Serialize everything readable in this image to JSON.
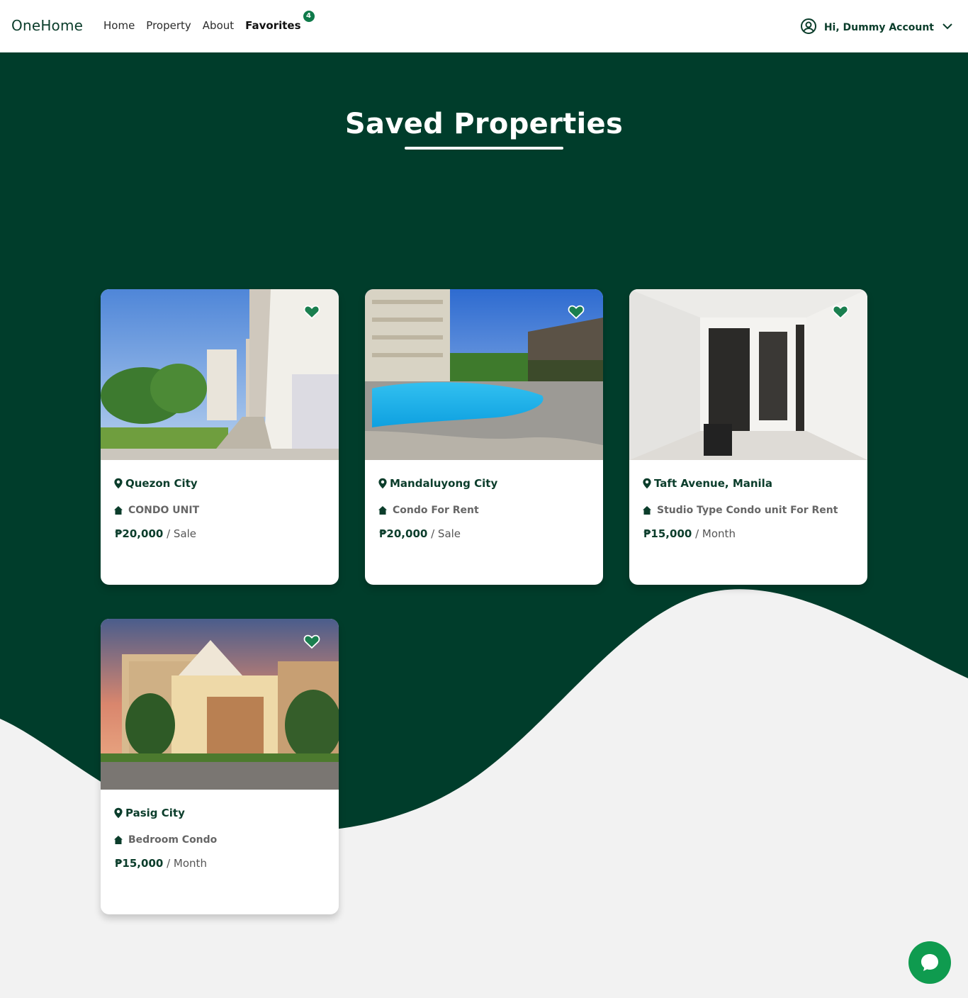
{
  "nav": {
    "brand": "OneHome",
    "links": [
      {
        "label": "Home"
      },
      {
        "label": "Property"
      },
      {
        "label": "About"
      },
      {
        "label": "Favorites"
      }
    ],
    "favorites_count": "4",
    "account_label": "Hi, Dummy Account"
  },
  "page": {
    "title": "Saved Properties"
  },
  "colors": {
    "brand_dark": "#003d2b",
    "accent": "#0f7a4a",
    "chat": "#0f9b4f",
    "page_bg": "#f2f2f2"
  },
  "properties": [
    {
      "location": "Quezon City",
      "type": "CONDO UNIT",
      "price": "₱20,000",
      "period": "/ Sale",
      "favorited": true
    },
    {
      "location": "Mandaluyong City",
      "type": "Condo For Rent",
      "price": "₱20,000",
      "period": "/ Sale",
      "favorited": true
    },
    {
      "location": "Taft Avenue, Manila",
      "type": " Studio Type Condo unit For Rent",
      "price": "₱15,000",
      "period": "/ Month",
      "favorited": true
    },
    {
      "location": "Pasig City",
      "type": "Bedroom Condo",
      "price": "₱15,000",
      "period": "/ Month",
      "favorited": true
    }
  ],
  "icons": {
    "user": "user-circle-icon",
    "dropdown": "chevron-down-icon",
    "location": "map-pin-icon",
    "type": "home-icon",
    "favorite": "heart-icon",
    "chat": "chat-bubble-icon"
  }
}
